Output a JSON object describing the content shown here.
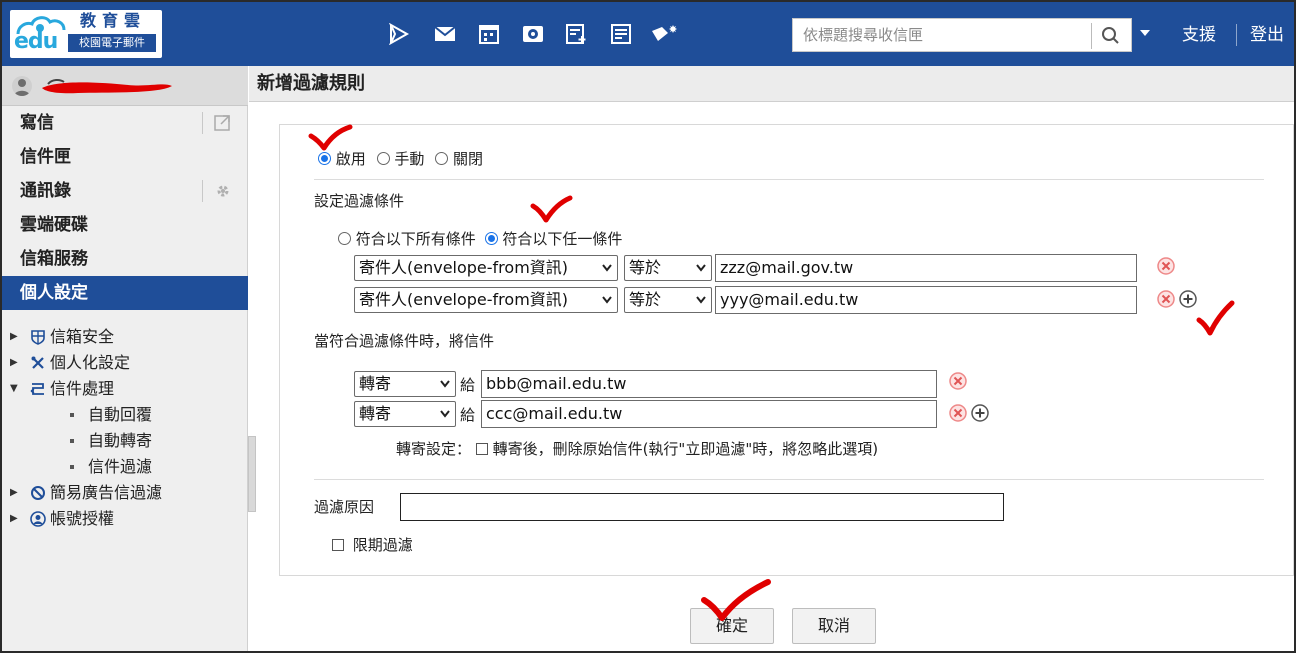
{
  "app": {
    "logo_edu": "edu",
    "logo_brand": "教育雲",
    "logo_sub": "校園電子郵件"
  },
  "toolbar": {
    "icons": [
      "send-arrow-icon",
      "mail-icon",
      "calendar-icon",
      "drive-icon",
      "new-document-icon",
      "notes-icon",
      "tag-settings-icon"
    ],
    "search_placeholder": "依標題搜尋收信匣",
    "support_label": "支援",
    "logout_label": "登出"
  },
  "sidebar": {
    "menu": [
      {
        "label": "寫信",
        "action_icon": "external-window-icon"
      },
      {
        "label": "信件匣"
      },
      {
        "label": "通訊錄",
        "action_icon": "gear-icon"
      },
      {
        "label": "雲端硬碟"
      },
      {
        "label": "信箱服務"
      },
      {
        "label": "個人設定",
        "active": true
      }
    ],
    "tree": [
      {
        "label": "信箱安全",
        "icon": "shield-icon"
      },
      {
        "label": "個人化設定",
        "icon": "tools-icon"
      },
      {
        "label": "信件處理",
        "icon": "mail-process-icon",
        "expanded": true,
        "children": [
          {
            "label": "自動回覆"
          },
          {
            "label": "自動轉寄"
          },
          {
            "label": "信件過濾"
          }
        ]
      },
      {
        "label": "簡易廣告信過濾",
        "icon": "block-icon"
      },
      {
        "label": "帳號授權",
        "icon": "account-icon"
      }
    ]
  },
  "main": {
    "title": "新增過濾規則",
    "status": {
      "options": [
        "啟用",
        "手動",
        "關閉"
      ],
      "selected": "啟用"
    },
    "conditions": {
      "heading": "設定過濾條件",
      "match_options": [
        "符合以下所有條件",
        "符合以下任一條件"
      ],
      "match_selected": "符合以下任一條件",
      "rows": [
        {
          "field": "寄件人(envelope-from資訊)",
          "operator": "等於",
          "value": "zzz@mail.gov.tw"
        },
        {
          "field": "寄件人(envelope-from資訊)",
          "operator": "等於",
          "value": "yyy@mail.edu.tw"
        }
      ]
    },
    "actions": {
      "heading": "當符合過濾條件時，將信件",
      "to_label": "給",
      "rows": [
        {
          "action": "轉寄",
          "value": "bbb@mail.edu.tw"
        },
        {
          "action": "轉寄",
          "value": "ccc@mail.edu.tw"
        }
      ],
      "forward_setting_label": "轉寄設定：",
      "forward_option": "轉寄後，刪除原始信件(執行\"立即過濾\"時，將忽略此選項)"
    },
    "reason": {
      "label": "過濾原因",
      "value": ""
    },
    "time_limit": {
      "label": "限期過濾"
    },
    "buttons": {
      "confirm": "確定",
      "cancel": "取消"
    }
  },
  "colors": {
    "brand": "#1f4e99",
    "radio_selected": "#1a73e8",
    "delete": "#e57373",
    "annotation_mark": "#e00000"
  }
}
